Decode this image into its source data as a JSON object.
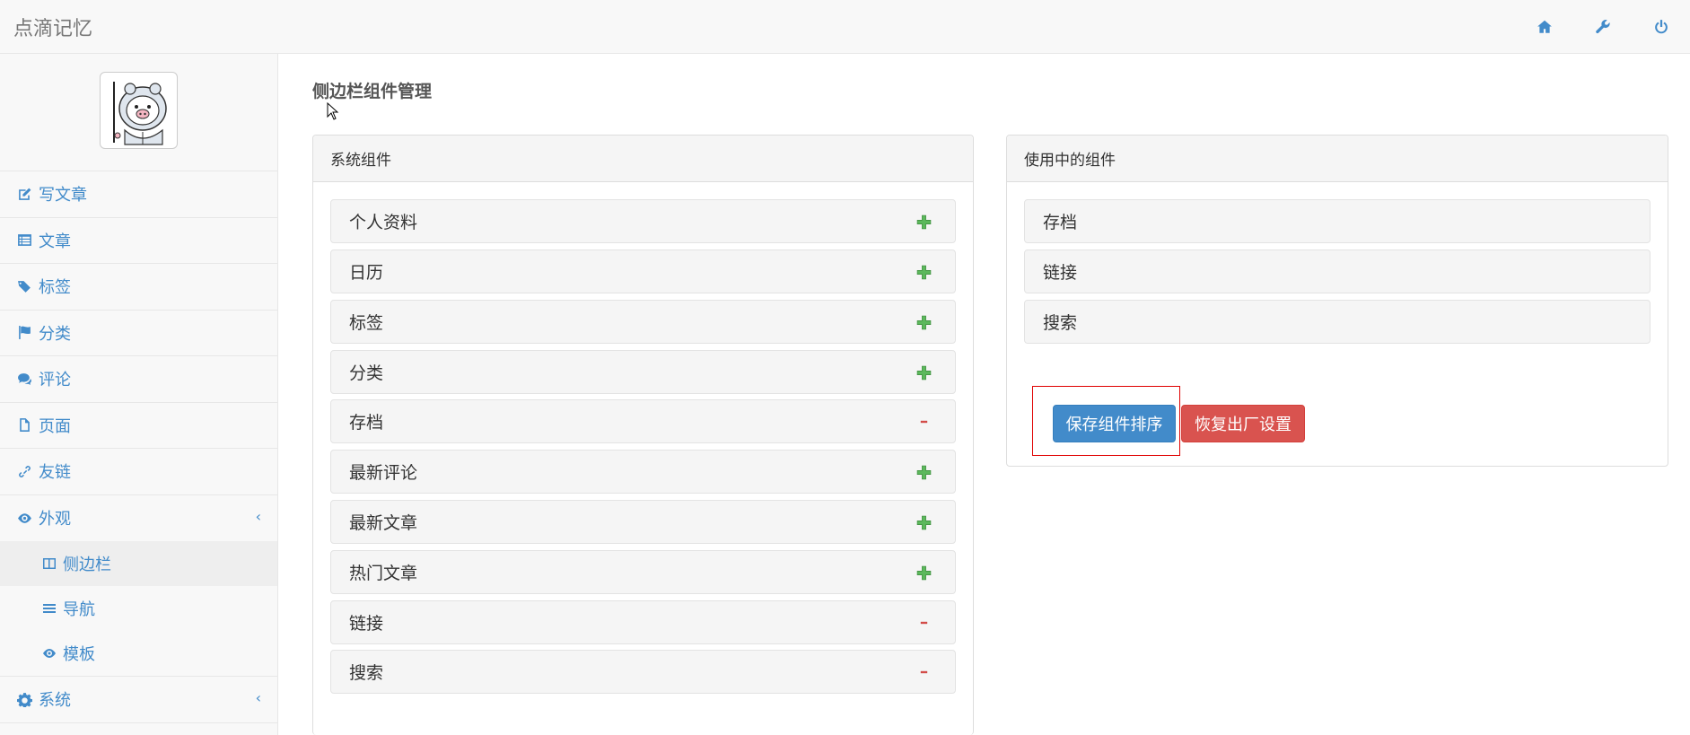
{
  "app": {
    "brand": "点滴记忆"
  },
  "header": {
    "icons": [
      "home-icon",
      "wrench-icon",
      "power-icon"
    ]
  },
  "sidebar": {
    "items": [
      {
        "label": "写文章",
        "icon": "edit-icon"
      },
      {
        "label": "文章",
        "icon": "list-icon"
      },
      {
        "label": "标签",
        "icon": "tags-icon"
      },
      {
        "label": "分类",
        "icon": "flag-icon"
      },
      {
        "label": "评论",
        "icon": "comments-icon"
      },
      {
        "label": "页面",
        "icon": "file-icon"
      },
      {
        "label": "友链",
        "icon": "link-icon"
      },
      {
        "label": "外观",
        "icon": "eye-icon",
        "caret": "‹"
      }
    ],
    "sub_items": [
      {
        "label": "侧边栏",
        "icon": "columns-icon",
        "active": true
      },
      {
        "label": "导航",
        "icon": "bars-icon"
      },
      {
        "label": "模板",
        "icon": "eye-icon"
      }
    ],
    "system": {
      "label": "系统",
      "icon": "gear-icon",
      "caret": "‹"
    }
  },
  "main": {
    "title": "侧边栏组件管理",
    "system_panel": {
      "heading": "系统组件",
      "widgets": [
        {
          "label": "个人资料",
          "action": "add"
        },
        {
          "label": "日历",
          "action": "add"
        },
        {
          "label": "标签",
          "action": "add"
        },
        {
          "label": "分类",
          "action": "add"
        },
        {
          "label": "存档",
          "action": "remove"
        },
        {
          "label": "最新评论",
          "action": "add"
        },
        {
          "label": "最新文章",
          "action": "add"
        },
        {
          "label": "热门文章",
          "action": "add"
        },
        {
          "label": "链接",
          "action": "remove"
        },
        {
          "label": "搜索",
          "action": "remove"
        }
      ]
    },
    "active_panel": {
      "heading": "使用中的组件",
      "widgets": [
        {
          "label": "存档"
        },
        {
          "label": "链接"
        },
        {
          "label": "搜索"
        }
      ],
      "save_button": "保存组件排序",
      "reset_button": "恢复出厂设置"
    }
  },
  "colors": {
    "link": "#428bca",
    "add": "#5cb85c",
    "remove": "#d9534f"
  }
}
